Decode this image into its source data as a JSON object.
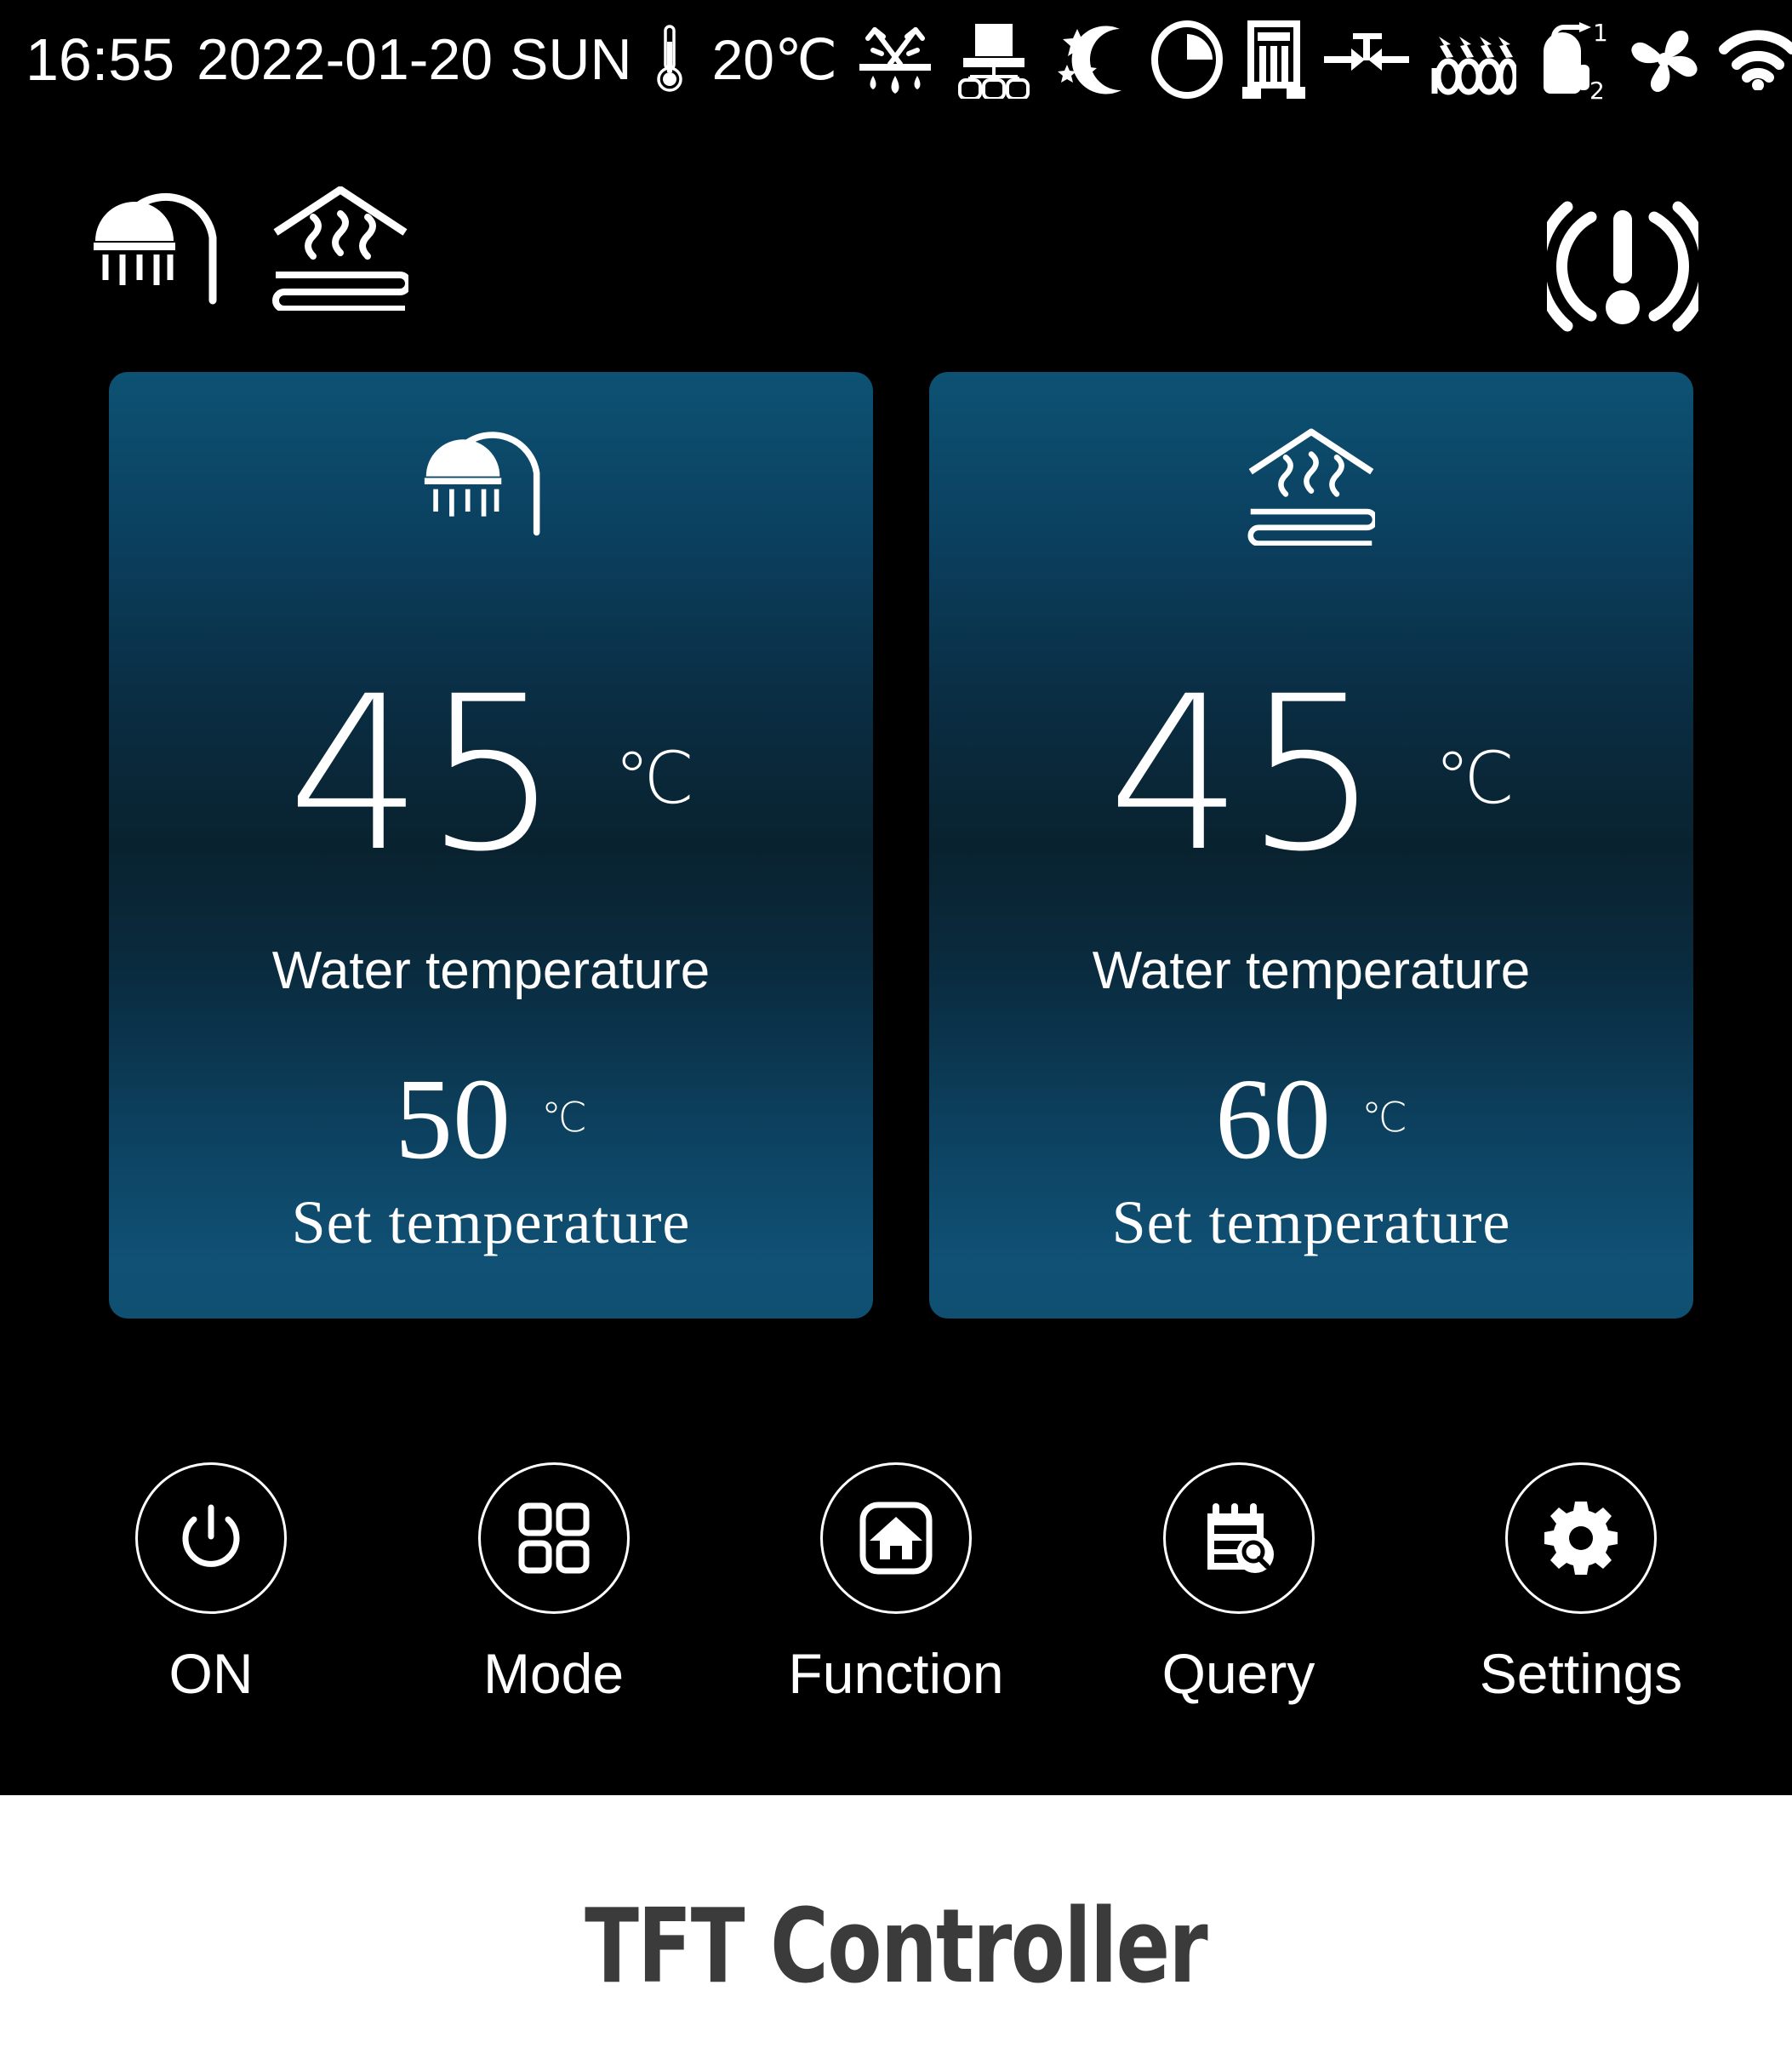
{
  "status_bar": {
    "time": "16:55",
    "date": "2022-01-20",
    "weekday": "SUN",
    "outdoor_temp": "20℃",
    "icons": [
      "thermometer-icon",
      "defrost-icon",
      "solar-collector-icon",
      "night-mode-icon",
      "timer-clock-icon",
      "water-tank-icon",
      "valve-icon",
      "heating-coil-icon",
      "gas-boiler-1-2-icon",
      "fan-icon",
      "wifi-icon"
    ]
  },
  "mode_row": {
    "shower_icon": "shower-icon",
    "floor_heating_icon": "floor-heating-icon",
    "alarm_icon": "alarm-icon"
  },
  "cards": [
    {
      "id": "shower",
      "icon": "shower-icon",
      "current_value": "45",
      "current_unit": "℃",
      "current_label": "Water temperature",
      "set_value": "50",
      "set_unit": "℃",
      "set_label": "Set temperature"
    },
    {
      "id": "floor-heating",
      "icon": "floor-heating-icon",
      "current_value": "45",
      "current_unit": "℃",
      "current_label": "Water temperature",
      "set_value": "60",
      "set_unit": "℃",
      "set_label": "Set temperature"
    }
  ],
  "nav": [
    {
      "label": "ON",
      "icon": "power-icon"
    },
    {
      "label": "Mode",
      "icon": "grid-icon"
    },
    {
      "label": "Function",
      "icon": "home-icon"
    },
    {
      "label": "Query",
      "icon": "notepad-search-icon"
    },
    {
      "label": "Settings",
      "icon": "gear-icon"
    }
  ],
  "caption": "TFT Controller",
  "colors": {
    "screen_background": "#000000",
    "card_gradient_top": "#0d5273",
    "card_gradient_mid": "#09222f",
    "card_gradient_bottom": "#105175",
    "foreground": "#ffffff",
    "caption_text": "#3b3b3b",
    "caption_background": "#ffffff"
  }
}
